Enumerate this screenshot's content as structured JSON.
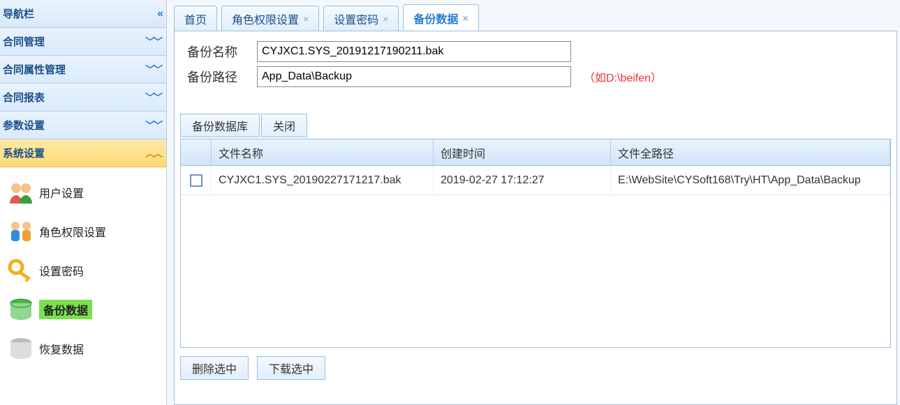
{
  "sidebar": {
    "title": "导航栏",
    "groups": [
      {
        "label": "合同管理",
        "expanded": false
      },
      {
        "label": "合同属性管理",
        "expanded": false
      },
      {
        "label": "合同报表",
        "expanded": false
      },
      {
        "label": "参数设置",
        "expanded": false
      },
      {
        "label": "系统设置",
        "expanded": true
      }
    ],
    "items": [
      {
        "label": "用户设置",
        "icon": "people-icon"
      },
      {
        "label": "角色权限设置",
        "icon": "roles-icon"
      },
      {
        "label": "设置密码",
        "icon": "key-icon"
      },
      {
        "label": "备份数据",
        "icon": "backup-icon",
        "active": true
      },
      {
        "label": "恢复数据",
        "icon": "restore-icon"
      }
    ]
  },
  "tabs": [
    {
      "label": "首页",
      "closable": false
    },
    {
      "label": "角色权限设置",
      "closable": true
    },
    {
      "label": "设置密码",
      "closable": true
    },
    {
      "label": "备份数据",
      "closable": true,
      "active": true
    }
  ],
  "form": {
    "name_label": "备份名称",
    "name_value": "CYJXC1.SYS_20191217190211.bak",
    "path_label": "备份路径",
    "path_value": "App_Data\\Backup",
    "path_hint": "（如D:\\beifen）"
  },
  "toolbar": {
    "backup_label": "备份数据库",
    "close_label": "关闭"
  },
  "grid": {
    "headers": {
      "name": "文件名称",
      "time": "创建时间",
      "path": "文件全路径"
    },
    "rows": [
      {
        "name": "CYJXC1.SYS_20190227171217.bak",
        "time": "2019-02-27 17:12:27",
        "path": "E:\\WebSite\\CYSoft168\\Try\\HT\\App_Data\\Backup"
      }
    ]
  },
  "footer": {
    "delete_label": "删除选中",
    "download_label": "下载选中"
  }
}
